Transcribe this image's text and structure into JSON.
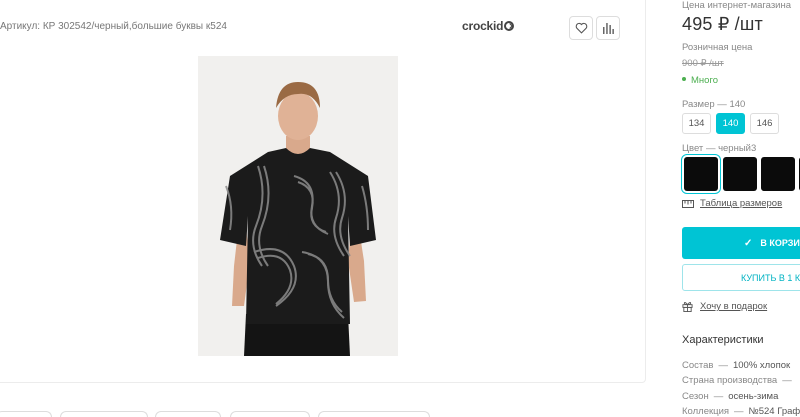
{
  "product": {
    "article": "Артикул: КР 302542/черный,большие буквы к524",
    "brand": "crockid",
    "favorite_icon": "heart-icon",
    "compare_icon": "bar-chart-icon"
  },
  "pricing": {
    "store_price_label": "Цена интернет-магазина",
    "price": "495 ₽ /шт",
    "retail_label": "Розничная цена",
    "old_price": "900 ₽ /шт",
    "stock": "Много"
  },
  "size": {
    "label": "Размер",
    "dash": "—",
    "selected": "140",
    "options": [
      "134",
      "140",
      "146"
    ]
  },
  "color": {
    "label": "Цвет",
    "dash": "—",
    "selected": "черный3",
    "swatch_color": "#0b0b0b"
  },
  "size_table_link": "Таблица размеров",
  "actions": {
    "cart_label": "В КОРЗИ",
    "oneclick_label": "КУПИТЬ В 1 К",
    "gift_link": "Хочу в подарок"
  },
  "specs": {
    "title": "Характеристики",
    "rows": [
      {
        "k": "Состав",
        "v": "100% хлопок"
      },
      {
        "k": "Страна производства",
        "v": ""
      },
      {
        "k": "Сезон",
        "v": "осень-зима"
      },
      {
        "k": "Коллекция",
        "v": "№524 Граф"
      }
    ]
  },
  "colors": {
    "accent": "#00c4d4",
    "stock": "#4caf50"
  }
}
